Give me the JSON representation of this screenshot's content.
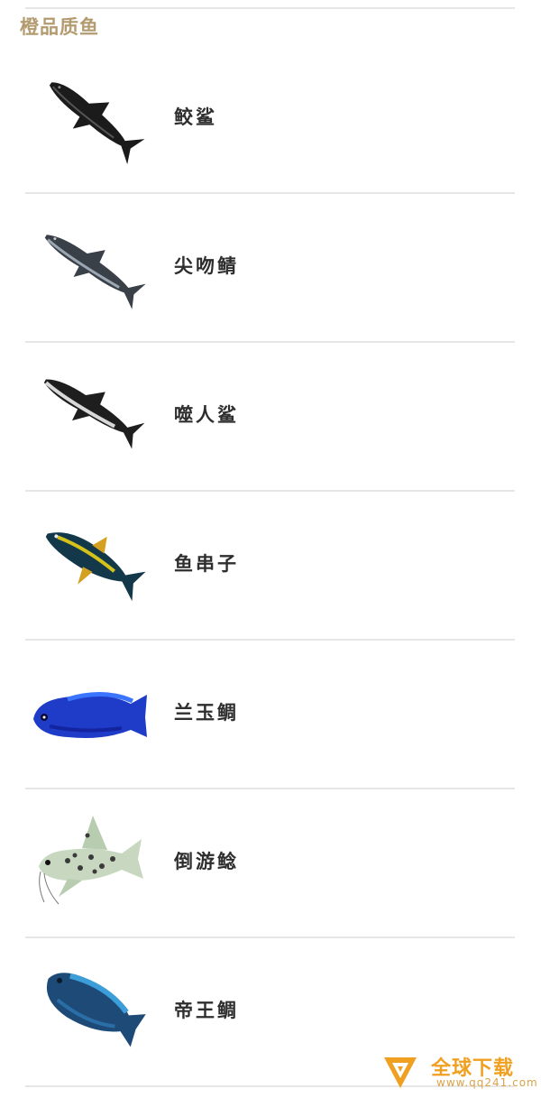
{
  "section": {
    "title": "橙品质鱼"
  },
  "fish": [
    {
      "name": "鲛鲨",
      "icon": "dark-shark-icon"
    },
    {
      "name": "尖吻鲭",
      "icon": "gray-shark-icon"
    },
    {
      "name": "噬人鲨",
      "icon": "great-white-shark-icon"
    },
    {
      "name": "鱼串子",
      "icon": "tuna-icon"
    },
    {
      "name": "兰玉鲷",
      "icon": "blue-cichlid-icon"
    },
    {
      "name": "倒游鲶",
      "icon": "spotted-catfish-icon"
    },
    {
      "name": "帝王鲷",
      "icon": "emperor-cichlid-icon"
    }
  ],
  "watermark": {
    "text": "全球下载",
    "url": "www.qq241.com",
    "color": "#f0a020"
  },
  "colors": {
    "title": "#b39b6f",
    "divider": "#e6e6e6",
    "name_text": "#2e2e2e"
  }
}
